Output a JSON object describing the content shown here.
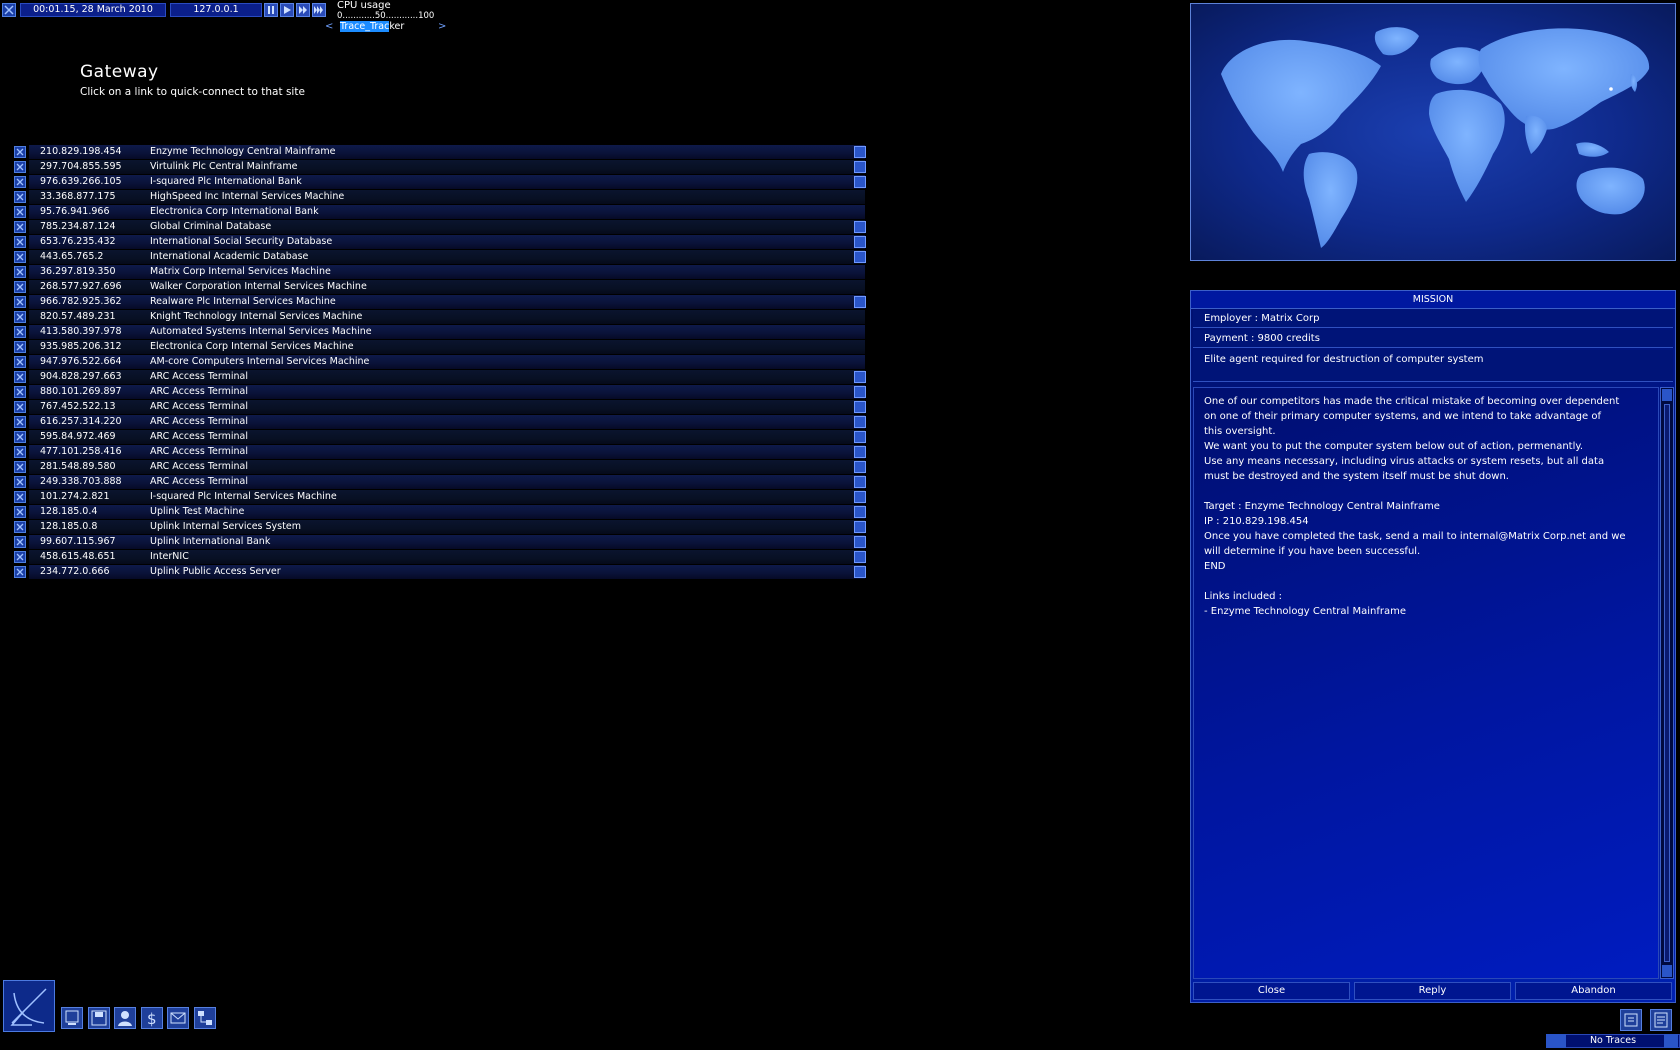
{
  "topbar": {
    "datetime": "00:01.15, 28 March 2010",
    "ip": "127.0.0.1",
    "cpu_label": "CPU usage",
    "cpu_scale": "0............50............100",
    "trace_hl": "Trace_Trac",
    "trace_rest": "ker"
  },
  "page": {
    "title": "Gateway",
    "subtitle": "Click on a link to quick-connect to that site"
  },
  "links": [
    {
      "ip": "210.829.198.454",
      "name": "Enzyme Technology Central Mainframe",
      "bookmark": true
    },
    {
      "ip": "297.704.855.595",
      "name": "Virtulink Plc Central Mainframe",
      "bookmark": true
    },
    {
      "ip": "976.639.266.105",
      "name": "I-squared Plc International Bank",
      "bookmark": true
    },
    {
      "ip": "33.368.877.175",
      "name": "HighSpeed Inc Internal Services Machine",
      "bookmark": false
    },
    {
      "ip": "95.76.941.966",
      "name": "Electronica Corp International Bank",
      "bookmark": false
    },
    {
      "ip": "785.234.87.124",
      "name": "Global Criminal Database",
      "bookmark": true
    },
    {
      "ip": "653.76.235.432",
      "name": "International Social Security Database",
      "bookmark": true
    },
    {
      "ip": "443.65.765.2",
      "name": "International Academic Database",
      "bookmark": true
    },
    {
      "ip": "36.297.819.350",
      "name": "Matrix Corp Internal Services Machine",
      "bookmark": false
    },
    {
      "ip": "268.577.927.696",
      "name": "Walker Corporation Internal Services Machine",
      "bookmark": false
    },
    {
      "ip": "966.782.925.362",
      "name": "Realware Plc Internal Services Machine",
      "bookmark": true
    },
    {
      "ip": "820.57.489.231",
      "name": "Knight Technology Internal Services Machine",
      "bookmark": false
    },
    {
      "ip": "413.580.397.978",
      "name": "Automated Systems Internal Services Machine",
      "bookmark": false
    },
    {
      "ip": "935.985.206.312",
      "name": "Electronica Corp Internal Services Machine",
      "bookmark": false
    },
    {
      "ip": "947.976.522.664",
      "name": "AM-core Computers Internal Services Machine",
      "bookmark": false
    },
    {
      "ip": "904.828.297.663",
      "name": "ARC Access Terminal",
      "bookmark": true
    },
    {
      "ip": "880.101.269.897",
      "name": "ARC Access Terminal",
      "bookmark": true
    },
    {
      "ip": "767.452.522.13",
      "name": "ARC Access Terminal",
      "bookmark": true
    },
    {
      "ip": "616.257.314.220",
      "name": "ARC Access Terminal",
      "bookmark": true
    },
    {
      "ip": "595.84.972.469",
      "name": "ARC Access Terminal",
      "bookmark": true
    },
    {
      "ip": "477.101.258.416",
      "name": "ARC Access Terminal",
      "bookmark": true
    },
    {
      "ip": "281.548.89.580",
      "name": "ARC Access Terminal",
      "bookmark": true
    },
    {
      "ip": "249.338.703.888",
      "name": "ARC Access Terminal",
      "bookmark": true
    },
    {
      "ip": "101.274.2.821",
      "name": "I-squared Plc Internal Services Machine",
      "bookmark": true
    },
    {
      "ip": "128.185.0.4",
      "name": "Uplink Test Machine",
      "bookmark": true
    },
    {
      "ip": "128.185.0.8",
      "name": "Uplink Internal Services System",
      "bookmark": true
    },
    {
      "ip": "99.607.115.967",
      "name": "Uplink International Bank",
      "bookmark": true
    },
    {
      "ip": "458.615.48.651",
      "name": "InterNIC",
      "bookmark": true
    },
    {
      "ip": "234.772.0.666",
      "name": "Uplink Public Access Server",
      "bookmark": true
    }
  ],
  "mission": {
    "header": "MISSION",
    "employer": "Employer : Matrix Corp",
    "payment": "Payment : 9800 credits",
    "description": "Elite agent required for destruction of computer system",
    "body": "One of our competitors has made the critical mistake of becoming over dependent\non one of their primary computer systems, and we intend to take advantage of\nthis oversight.\nWe want you to put the computer system below out of action, permenantly.\nUse any means necessary, including virus attacks or system resets, but all data\nmust be destroyed and the system itself must be shut down.\n\nTarget : Enzyme Technology Central Mainframe\nIP : 210.829.198.454\nOnce you have completed the task, send a mail to internal@Matrix Corp.net and we\nwill determine if you have been successful.\nEND\n\nLinks included :\n- Enzyme Technology Central Mainframe",
    "buttons": {
      "close": "Close",
      "reply": "Reply",
      "abandon": "Abandon"
    }
  },
  "status": {
    "traces": "No Traces"
  },
  "colors": {
    "accent": "#1c8cff",
    "panel": "#0018a0",
    "row": "#0e1a4a"
  }
}
